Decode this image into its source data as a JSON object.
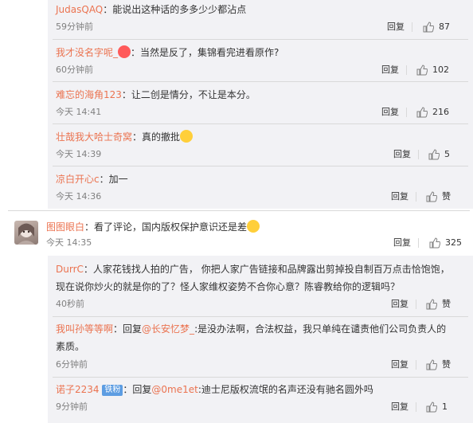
{
  "reply_label": "回复",
  "like_label": "赞",
  "nested_top": [
    {
      "user": "JudasQAQ",
      "text": "能说出这种话的多多少少都沾点",
      "time": "59分钟前",
      "likes": "87"
    },
    {
      "user": "我才没名字呢_",
      "text": "当然是反了，集锦看完进看原作?",
      "time": "60分钟前",
      "likes": "102"
    },
    {
      "user": "难忘的海角123",
      "text": "让二创是情分，不让是本分。",
      "time": "今天 14:41",
      "likes": "216"
    },
    {
      "user": "壮哉我大哈士奇窝",
      "text": "真的撤批",
      "time": "今天 14:39",
      "likes": "5"
    },
    {
      "user": "凉白开心c",
      "text": "加一",
      "time": "今天 14:36",
      "likes": ""
    }
  ],
  "main_comment": {
    "user": "图图眼白",
    "text": "看了评论，国内版权保护意识还是差",
    "time": "今天 14:35",
    "likes": "325"
  },
  "nested_bottom": [
    {
      "user": "DurrC",
      "text1": "人家花钱找人拍的广告， 你把人家广告链接和品牌露出剪掉投自制百万点击恰饱饱，",
      "text2": "现在说你炒火的就是你的了？怪人家维权姿势不合你心意？陈睿教给你的逻辑吗？",
      "time": "40秒前",
      "likes": ""
    },
    {
      "user": "我叫孙等等啊",
      "reply_word": "回复",
      "mention": "@长安忆梦_",
      "text1": ":是没办法啊，合法权益，我只单纯在谴责他们公司负责人的",
      "text2": "素质。",
      "time": "6分钟前",
      "likes": ""
    },
    {
      "user": "诺子2234",
      "badge": "铁粉",
      "reply_word": "回复",
      "mention": "@0me1et",
      "text1": ":迪士尼版权流氓的名声还没有驰名圆外吗",
      "time": "9分钟前",
      "likes": "1"
    }
  ]
}
